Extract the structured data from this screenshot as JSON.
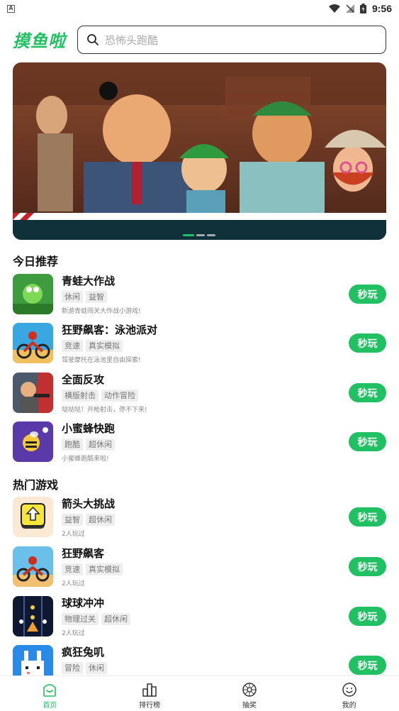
{
  "status_bar": {
    "time": "9:56"
  },
  "header": {
    "logo": "摸鱼啦",
    "search_placeholder": "恐怖头跑酷"
  },
  "banner": {
    "active_index": 0,
    "dot_count": 3
  },
  "sections": {
    "today": "今日推荐",
    "hot": "热门游戏"
  },
  "today_games": [
    {
      "name": "青蛙大作战",
      "tags": [
        "休闲",
        "益智"
      ],
      "desc": "新游青蛙闯关大作战小游戏!",
      "play": "秒玩"
    },
    {
      "name": "狂野飙客：泳池派对",
      "tags": [
        "竞速",
        "真实模拟"
      ],
      "desc": "驾驶摩托在泳池里自由探索!",
      "play": "秒玩"
    },
    {
      "name": "全面反攻",
      "tags": [
        "横版射击",
        "动作冒险"
      ],
      "desc": "哒哒哒！开枪射击，停不下来!",
      "play": "秒玩"
    },
    {
      "name": "小蜜蜂快跑",
      "tags": [
        "跑酷",
        "超休闲"
      ],
      "desc": "小蜜蜂跑酷来啦!",
      "play": "秒玩"
    }
  ],
  "hot_games": [
    {
      "name": "箭头大挑战",
      "tags": [
        "益智",
        "超休闲"
      ],
      "desc": "2人玩过",
      "play": "秒玩"
    },
    {
      "name": "狂野飙客",
      "tags": [
        "竞速",
        "真实模拟"
      ],
      "desc": "2人玩过",
      "play": "秒玩"
    },
    {
      "name": "球球冲冲",
      "tags": [
        "物理过关",
        "超休闲"
      ],
      "desc": "2人玩过",
      "play": "秒玩"
    },
    {
      "name": "疯狂兔叽",
      "tags": [
        "冒险",
        "休闲"
      ],
      "desc": "",
      "play": "秒玩"
    }
  ],
  "nav": [
    {
      "label": "首页",
      "icon": "home-icon",
      "active": true
    },
    {
      "label": "排行榜",
      "icon": "ranking-icon",
      "active": false
    },
    {
      "label": "抽奖",
      "icon": "lottery-icon",
      "active": false
    },
    {
      "label": "我的",
      "icon": "profile-icon",
      "active": false
    }
  ],
  "colors": {
    "accent": "#21c163"
  }
}
